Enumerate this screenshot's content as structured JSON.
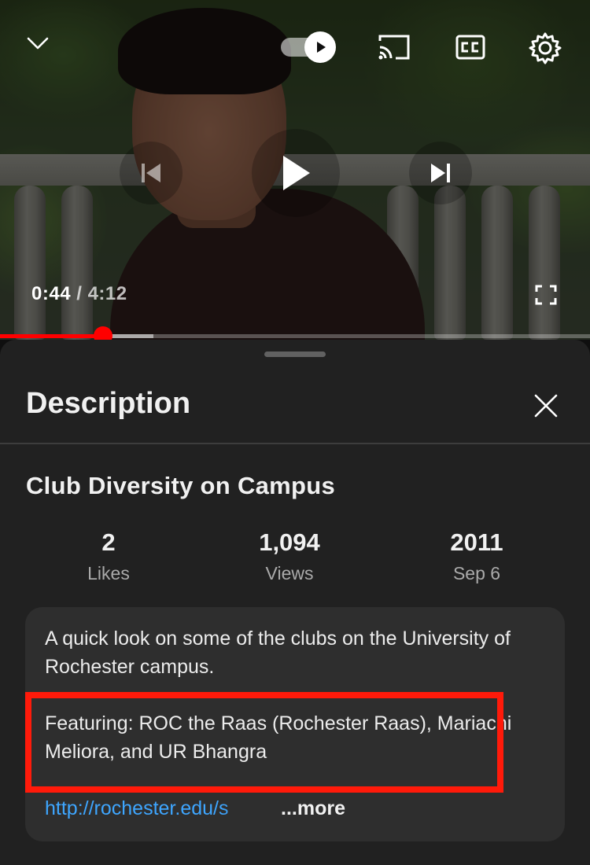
{
  "player": {
    "current_time": "0:44",
    "separator": "/",
    "duration": "4:12",
    "progress_fraction": 0.175,
    "buffered_fraction": 0.26,
    "accent_color": "#ff0000",
    "autoplay_on": true,
    "icons": {
      "collapse": "chevron-down-icon",
      "autoplay": "autoplay-toggle-icon",
      "cast": "cast-icon",
      "captions": "closed-captions-icon",
      "settings": "gear-icon",
      "previous": "skip-previous-icon",
      "play": "play-icon",
      "next": "skip-next-icon",
      "fullscreen": "fullscreen-icon"
    }
  },
  "sheet": {
    "title": "Description",
    "close_icon": "close-icon",
    "video_title": "Club Diversity on Campus",
    "stats": {
      "likes": {
        "value": "2",
        "label": "Likes"
      },
      "views": {
        "value": "1,094",
        "label": "Views"
      },
      "date": {
        "value": "2011",
        "label": "Sep 6"
      }
    },
    "description": {
      "paragraph1": "A quick look on some of the clubs on the University of Rochester campus.",
      "paragraph2": "Featuring: ROC the Raas (Rochester Raas), Mariachi Meliora, and UR Bhangra",
      "link": "http://rochester.edu/s",
      "more_label": "...more",
      "highlight_color": "#ff1a0a",
      "link_color": "#3ea6ff"
    }
  }
}
